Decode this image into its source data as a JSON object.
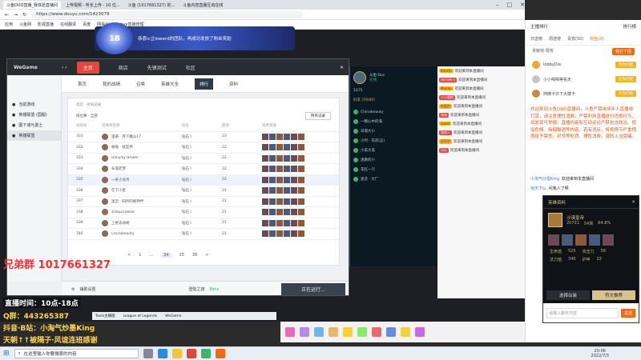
{
  "browser": {
    "tabs": [
      "斗鱼DUO直播_我体验直播间",
      "上传视频 - 听长上传 - 10 位...",
      "斗鱼 (1017661327) 的...",
      "斗鱼内容直播互动在线"
    ],
    "url": "https://www.douyu.com/1423079",
    "bookmarks": [
      "应用",
      "斗鱼网",
      "影视直播",
      "在线翻译",
      "百度",
      "网易云",
      "Active直播管理"
    ],
    "window_controls": [
      "–",
      "□",
      "✕"
    ]
  },
  "stream": {
    "group_text": "兄弟群 1017661327",
    "live_time": "直播时间：10点-18点",
    "qq": "Q群：443265387",
    "fans": "抖音·B站：小淘气炒墨King",
    "slogan": "天朝↑↑被隔子·风谊连班感谢",
    "banner_text": "恭喜Ic立lowerd的团队，再成功发放了粉丝奖励"
  },
  "wegame": {
    "title": "WeGame",
    "top_tabs": [
      "主页",
      "商店",
      "先锋测试",
      "社区"
    ],
    "sidebar": [
      "当前游戏",
      "英雄联盟 (国服)",
      "图下城与勇士",
      "英雄联盟"
    ],
    "sub_tabs": [
      "首页",
      "我的战绩",
      "召唤",
      "英雄大全",
      "排行",
      "资料"
    ],
    "breadcrumb": "首页 · 对局记录",
    "filter_label": "排位赛 · 全部",
    "filter_select": "所有记录",
    "columns": [
      "对局号",
      "召唤师名称",
      "段位",
      "胜场",
      "常用英雄"
    ],
    "rows": [
      {
        "no": "331",
        "name": "迷惑 · 月下魔山17",
        "rank": "钻石 I",
        "wins": "23"
      },
      {
        "no": "332",
        "name": "被抛 · 就是神",
        "rank": "钻石 I",
        "wins": "22"
      },
      {
        "no": "333",
        "name": "Unlucky Broker",
        "rank": "钻石 I",
        "wins": "22"
      },
      {
        "no": "334",
        "name": "长城老梦",
        "rank": "钻石 I",
        "wins": "22"
      },
      {
        "no": "335",
        "name": "一条小龙鸟",
        "rank": "钻石 I",
        "wins": "22"
      },
      {
        "no": "336",
        "name": "在下小星",
        "rank": "钻石 I",
        "wins": "21"
      },
      {
        "no": "337",
        "name": "迷恋 · 四月的眼神伴",
        "rank": "钻石 I",
        "wins": "21"
      },
      {
        "no": "338",
        "name": "zsdsjZsowad",
        "rank": "钻石 I",
        "wins": "21"
      },
      {
        "no": "339",
        "name": "上者去胡胡",
        "rank": "钻石 I",
        "wins": "21"
      },
      {
        "no": "340",
        "name": "Chinabeauty",
        "rank": "钻石 I",
        "wins": "21"
      }
    ],
    "pagination": [
      "<",
      "1",
      "...",
      "34",
      "35",
      "36",
      ">"
    ],
    "bottom_left": "辅助设置",
    "bottom_mid": "登陆之旅",
    "bottom_tag": "Beta",
    "game_button": "正在运行..."
  },
  "lol": {
    "level": "1475",
    "name": "斗鱼·Dus",
    "online_label": "在线",
    "group": "好友 (59/80)",
    "friends": [
      "Chinabeauty",
      "一颗心中的海",
      "日落大小",
      "小时 · 兄弟(正)",
      "小美大美",
      "迷路的小",
      "花红一只",
      "迷恋 · 大厂"
    ]
  },
  "chat_mid": {
    "messages": [
      "欢迎来到本直播间",
      "欢迎来到本直播间",
      "欢迎来到本直播间",
      "欢迎来到本直播间",
      "欢迎来到本直播间",
      "欢迎来到本直播间",
      "欢迎来到本直播间",
      "欢迎来到本直播间",
      "欢迎来到本直播间",
      "欢迎来到本直播间"
    ],
    "users": [
      "Blinkfo",
      "dorin的小",
      "Manbu",
      "小小喜悦",
      "亲爱的",
      "淘淘",
      "lowrd",
      "游戏人",
      "好同学",
      "乐乐"
    ]
  },
  "right": {
    "header": "主播排行",
    "sub_header": "排行榜",
    "tabs": [
      "日送榜",
      "周送榜",
      "贵宾(50)",
      "粉丝(2)"
    ],
    "rank_label": "贡献榜·周榜",
    "rank_button": "我打个招",
    "ranks": [
      {
        "name": "lobbyDia",
        "gift": "为你打招"
      },
      {
        "name": "小小喝喝等看天",
        "gift": "为你打招"
      },
      {
        "name": "阿姨卡尔下大楼卡",
        "gift": "为你打招"
      }
    ],
    "notice": "欢迎来到斗鱼OUO直播间，斗鱼严禁未成年人直播或打赏，请注意理性消费。严禁利用直播进行违规行为，如发现可举报。直播内容和互动评论严禁包含政治、低俗色情、吸烟酗酒等内容，若有违反，将视情节严重程度给予禁言、封号等处罚。理性消费，谨防上当受骗。",
    "welcome_user": "小淘气炒墨King",
    "welcome_text": "欢迎来到本直播间",
    "last_user": "倪天下lu",
    "last_text": "问我人了啊"
  },
  "card": {
    "title": "英雄资料",
    "hero_name": "沙漠皇帝",
    "games": "20731",
    "wins": "54场",
    "rate": "64.8%",
    "stat_labels": [
      "生命值",
      "攻击力",
      "法力值",
      "护甲"
    ],
    "stat_values": [
      "525",
      "58",
      "340",
      "22"
    ],
    "btn_left": "选择出装",
    "btn_right": "符文推荐",
    "input_placeholder": "请输入聊天内容",
    "send": "发送"
  },
  "taskbar": {
    "search_placeholder": "在这里输入你要搜索的内容",
    "apps": [
      "Tools主播版",
      "League of Legends",
      "WeGame"
    ],
    "time": "20:06",
    "date": "2022/7/3"
  },
  "colors": {
    "orange": "#f06a14",
    "gold": "#f7b21e",
    "dark": "#2a2c33",
    "accent": "#e8453c"
  }
}
